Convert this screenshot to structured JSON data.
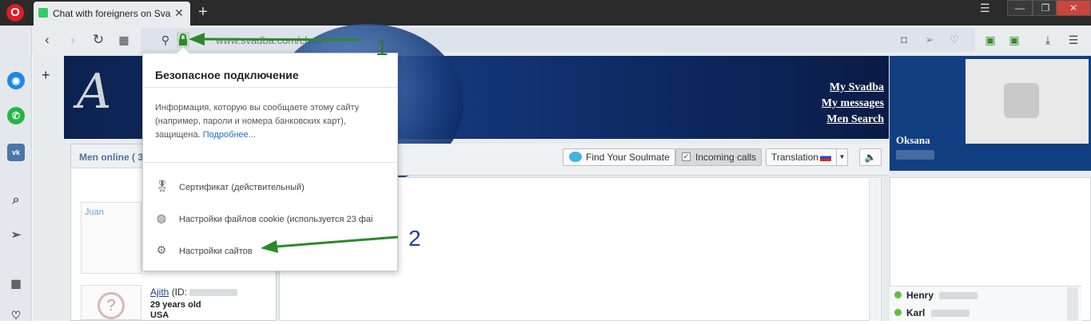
{
  "browser": {
    "tab_title": "Chat with foreigners on Sva",
    "url_text": "www.svadba.com/chat/",
    "new_tab": "+",
    "tab_close": "✕",
    "window": {
      "minimize": "—",
      "maximize": "❐",
      "close": "✕"
    },
    "sidebar_icons": [
      "messenger-icon",
      "whatsapp-icon",
      "vk-icon",
      "search-icon",
      "send-icon",
      "speed-dial-icon",
      "heart-icon"
    ]
  },
  "banner": {
    "logo_text": "A",
    "links": [
      "My Svadba",
      "My messages",
      "Men Search"
    ]
  },
  "profile": {
    "name": "Oksana"
  },
  "men_panel": {
    "title": "Men online ( 3",
    "members": [
      {
        "name": "Juan"
      },
      {
        "name": "Ajith",
        "id_prefix": "(ID:",
        "age": "29 years old",
        "country": "USA"
      }
    ]
  },
  "toolbar": {
    "soulmate": "Find Your Soulmate",
    "incoming": "Incoming calls",
    "translation": "Translation"
  },
  "online": [
    {
      "name": "Henry"
    },
    {
      "name": "Karl"
    }
  ],
  "popup": {
    "title": "Безопасное подключение",
    "description": "Информация, которую вы сообщаете этому сайту (например, пароли и номера банковских карт), защищена.",
    "more_link": "Подробнее...",
    "items": [
      "Сертификат (действительный)",
      "Настройки файлов cookie (используется 23 фаі",
      "Настройки сайтов"
    ]
  },
  "annotations": [
    "1",
    "2"
  ],
  "colors": {
    "accent_green": "#2a8a2a",
    "banner_blue": "#123f82",
    "link_blue": "#1f6ccf"
  }
}
